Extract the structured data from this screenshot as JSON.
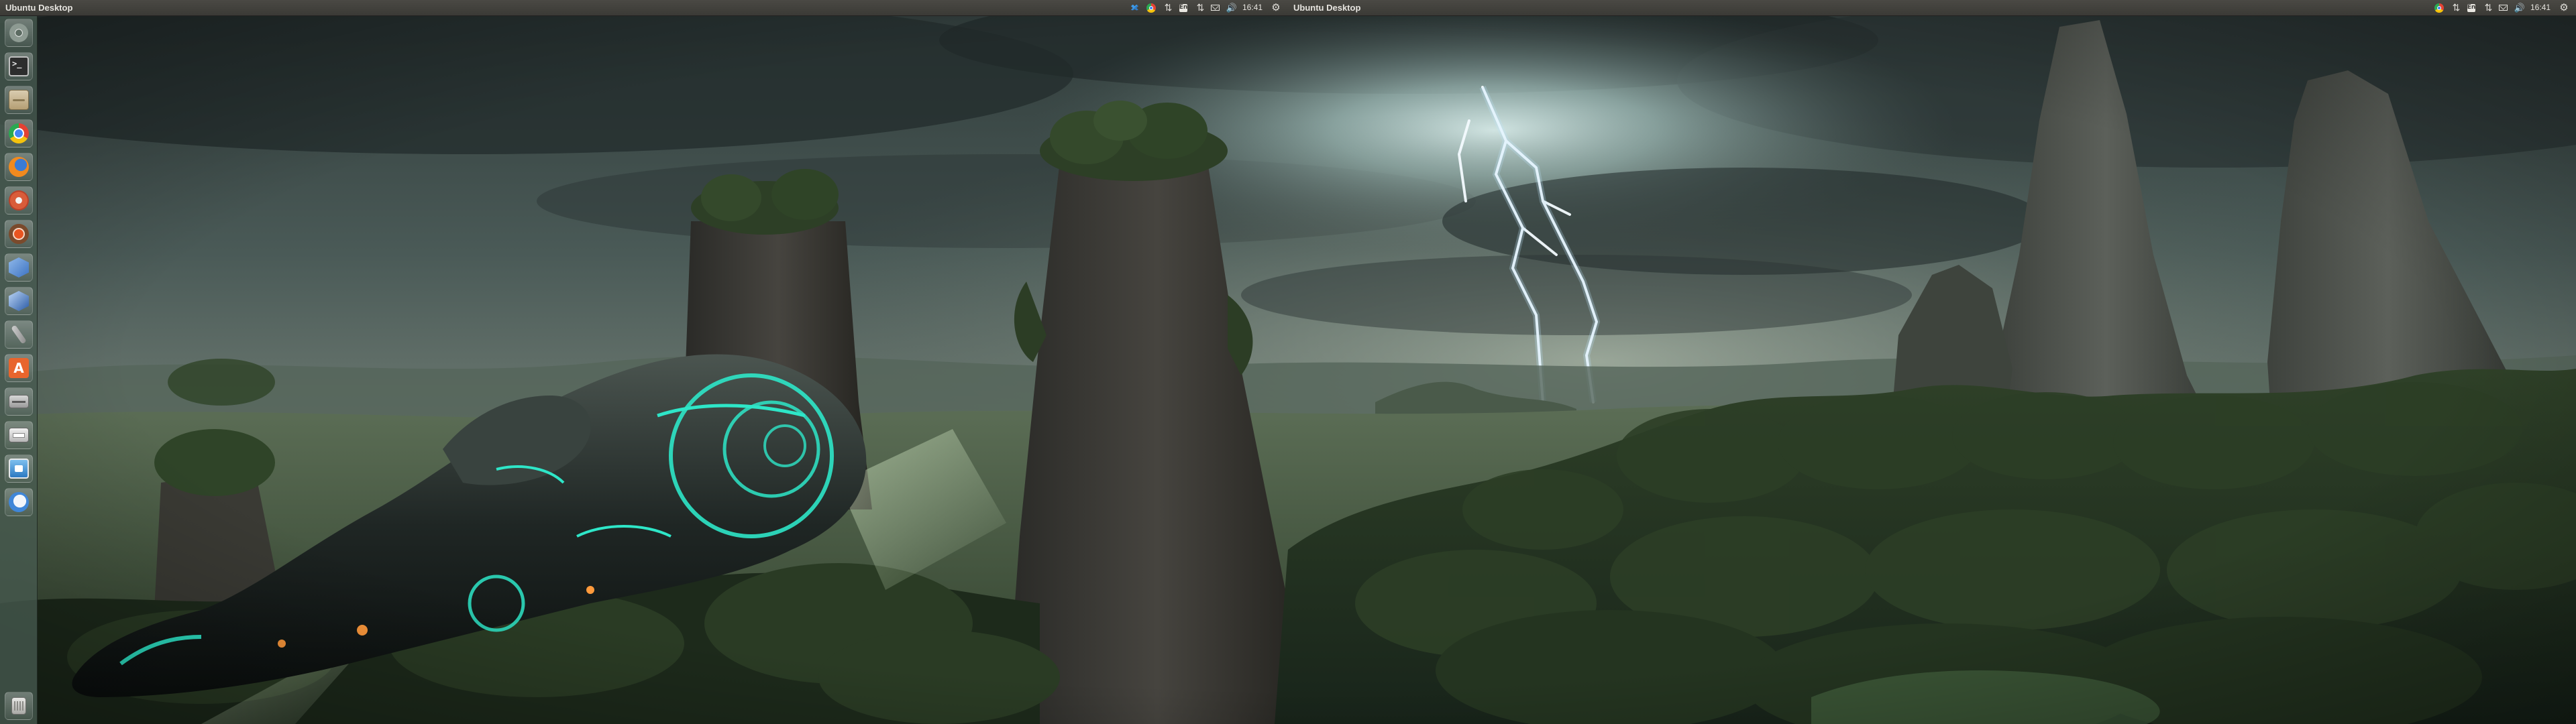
{
  "screen": {
    "left": {
      "panel_title": "Ubuntu Desktop",
      "clock": "16:41"
    },
    "right": {
      "panel_title": "Ubuntu Desktop",
      "clock": "16:41"
    }
  },
  "indicators": {
    "keyboard_layout": "En",
    "sync_arrows": "⇅",
    "volume": "🔊",
    "gear": "⚙"
  },
  "launcher": {
    "items": [
      {
        "name": "dash-home-icon"
      },
      {
        "name": "terminal-icon",
        "text": ">_"
      },
      {
        "name": "files-icon"
      },
      {
        "name": "chrome-icon"
      },
      {
        "name": "firefox-icon"
      },
      {
        "name": "system-settings-icon"
      },
      {
        "name": "software-updater-icon"
      },
      {
        "name": "virtualbox-icon"
      },
      {
        "name": "3d-cube-icon"
      },
      {
        "name": "tool-icon"
      },
      {
        "name": "ubuntu-software-center-icon",
        "text": "A"
      },
      {
        "name": "removable-drive-icon"
      },
      {
        "name": "printer-icon"
      },
      {
        "name": "screenshot-icon"
      },
      {
        "name": "thunderbird-icon"
      },
      {
        "name": "trash-icon"
      }
    ]
  },
  "colors": {
    "panel": "#3b3a36",
    "launcher": "#465a50",
    "sky": "#3c4a48",
    "forest": "#2a3a2a",
    "spaceship_glow": "#2ee6c8"
  }
}
